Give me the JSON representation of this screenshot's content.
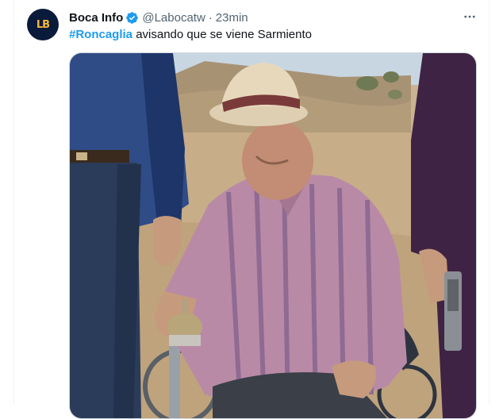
{
  "tweet": {
    "author_name": "Boca Info",
    "author_handle": "@Labocatw",
    "separator": "·",
    "timestamp": "23min",
    "avatar_text": "LB",
    "hashtag": "#Roncaglia",
    "body_text": " avisando que se viene Sarmiento",
    "more_icon": "more-horizontal-icon"
  },
  "colors": {
    "hashtag": "#1d9bf0",
    "verified": "#1d9bf0",
    "muted": "#536471",
    "avatar_bg": "#0a1a3a",
    "avatar_logo": "#f4b73a"
  }
}
